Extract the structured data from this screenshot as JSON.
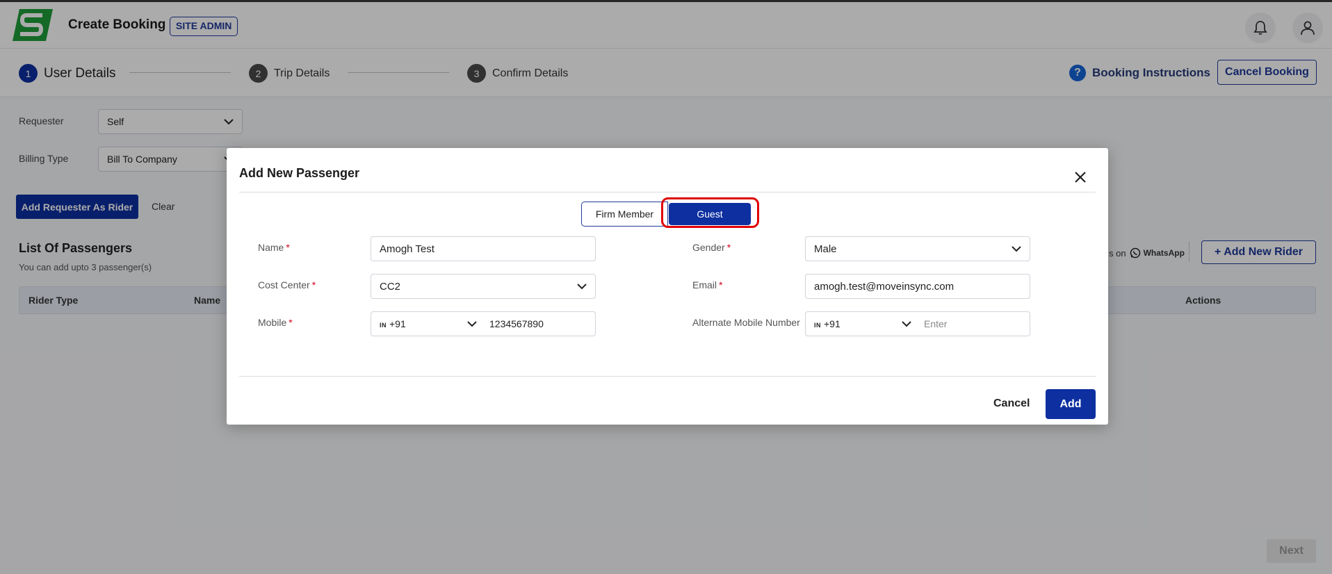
{
  "header": {
    "title": "Create Booking",
    "role_badge": "SITE ADMIN",
    "notification_icon": "bell-icon",
    "profile_icon": "user-icon"
  },
  "steps": [
    {
      "num": "1",
      "label": "User Details",
      "active": true
    },
    {
      "num": "2",
      "label": "Trip Details",
      "active": false
    },
    {
      "num": "3",
      "label": "Confirm Details",
      "active": false
    }
  ],
  "booking_instructions_label": "Booking Instructions",
  "help_icon_glyph": "?",
  "cancel_booking_label": "Cancel Booking",
  "form": {
    "requester_label": "Requester",
    "requester_value": "Self",
    "billing_label": "Billing Type",
    "billing_value": "Bill To Company"
  },
  "add_requester_label": "Add Requester As Rider",
  "clear_label": "Clear",
  "passengers": {
    "title": "List Of Passengers",
    "subtitle": "You can add upto 3 passenger(s)",
    "columns": [
      "Rider Type",
      "Name",
      "Actions"
    ],
    "notify_prefix": "s on",
    "whatsapp_label": "WhatsApp",
    "add_rider_label": "+ Add New Rider"
  },
  "next_label": "Next",
  "modal": {
    "title": "Add New Passenger",
    "toggle": {
      "firm_member": "Firm Member",
      "guest": "Guest",
      "selected": "Guest"
    },
    "fields": {
      "name": {
        "label": "Name",
        "value": "Amogh Test"
      },
      "gender": {
        "label": "Gender",
        "value": "Male"
      },
      "cost_center": {
        "label": "Cost Center",
        "value": "CC2"
      },
      "email": {
        "label": "Email",
        "value": "amogh.test@moveinsync.com"
      },
      "mobile": {
        "label": "Mobile",
        "country": "IN",
        "code": "+91",
        "value": "1234567890"
      },
      "alt_mobile": {
        "label": "Alternate Mobile Number",
        "country": "IN",
        "code": "+91",
        "placeholder": "Enter"
      }
    },
    "required_mark": "*",
    "cancel_label": "Cancel",
    "add_label": "Add"
  },
  "colors": {
    "primary": "#0d2fa0",
    "required": "#d0021b",
    "highlight": "#e00000",
    "logo_green": "#1f9d3a"
  }
}
